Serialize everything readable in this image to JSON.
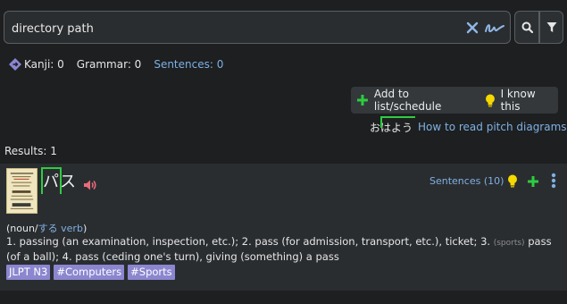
{
  "search": {
    "value": "directory path",
    "placeholder": ""
  },
  "stats": {
    "kanji": "Kanji: 0",
    "grammar": "Grammar: 0",
    "sentences": "Sentences: 0"
  },
  "actions": {
    "add_label": "Add to list/schedule",
    "know_label": "I know this"
  },
  "pitch_help": {
    "example": "おはよう",
    "link": "How to read pitch diagrams"
  },
  "results": {
    "count_label": "Results: 1",
    "entries": [
      {
        "headword": "パス",
        "sentences_link": "Sentences (10)",
        "pos_open": "(noun/",
        "pos_suru": "する",
        "pos_verb": " verb",
        "pos_close": ")",
        "def_part1": "1. passing (an examination, inspection, etc.); 2. pass (for admission, transport, etc.), ticket; 3. ",
        "def_field": "(sports)",
        "def_part2": " pass (of a ball); 4. pass (ceding one's turn), giving (something) a pass",
        "tags": [
          "JLPT N3",
          "#Computers",
          "#Sports"
        ]
      }
    ]
  },
  "icons": {
    "clear": "close-icon",
    "handwriting": "handwriting-icon",
    "search": "search-icon",
    "filter": "filter-icon",
    "stats": "diamond-icon",
    "add": "plus-icon",
    "know": "lightbulb-icon",
    "audio": "speaker-icon",
    "menu": "kebab-icon"
  },
  "colors": {
    "background": "#1d1f20",
    "panel": "#2a2d30",
    "link": "#7fb0e4",
    "accent_green": "#2ecc40",
    "tag": "#8b86cf",
    "bulb": "#f5d800",
    "speaker": "#e86b79"
  }
}
